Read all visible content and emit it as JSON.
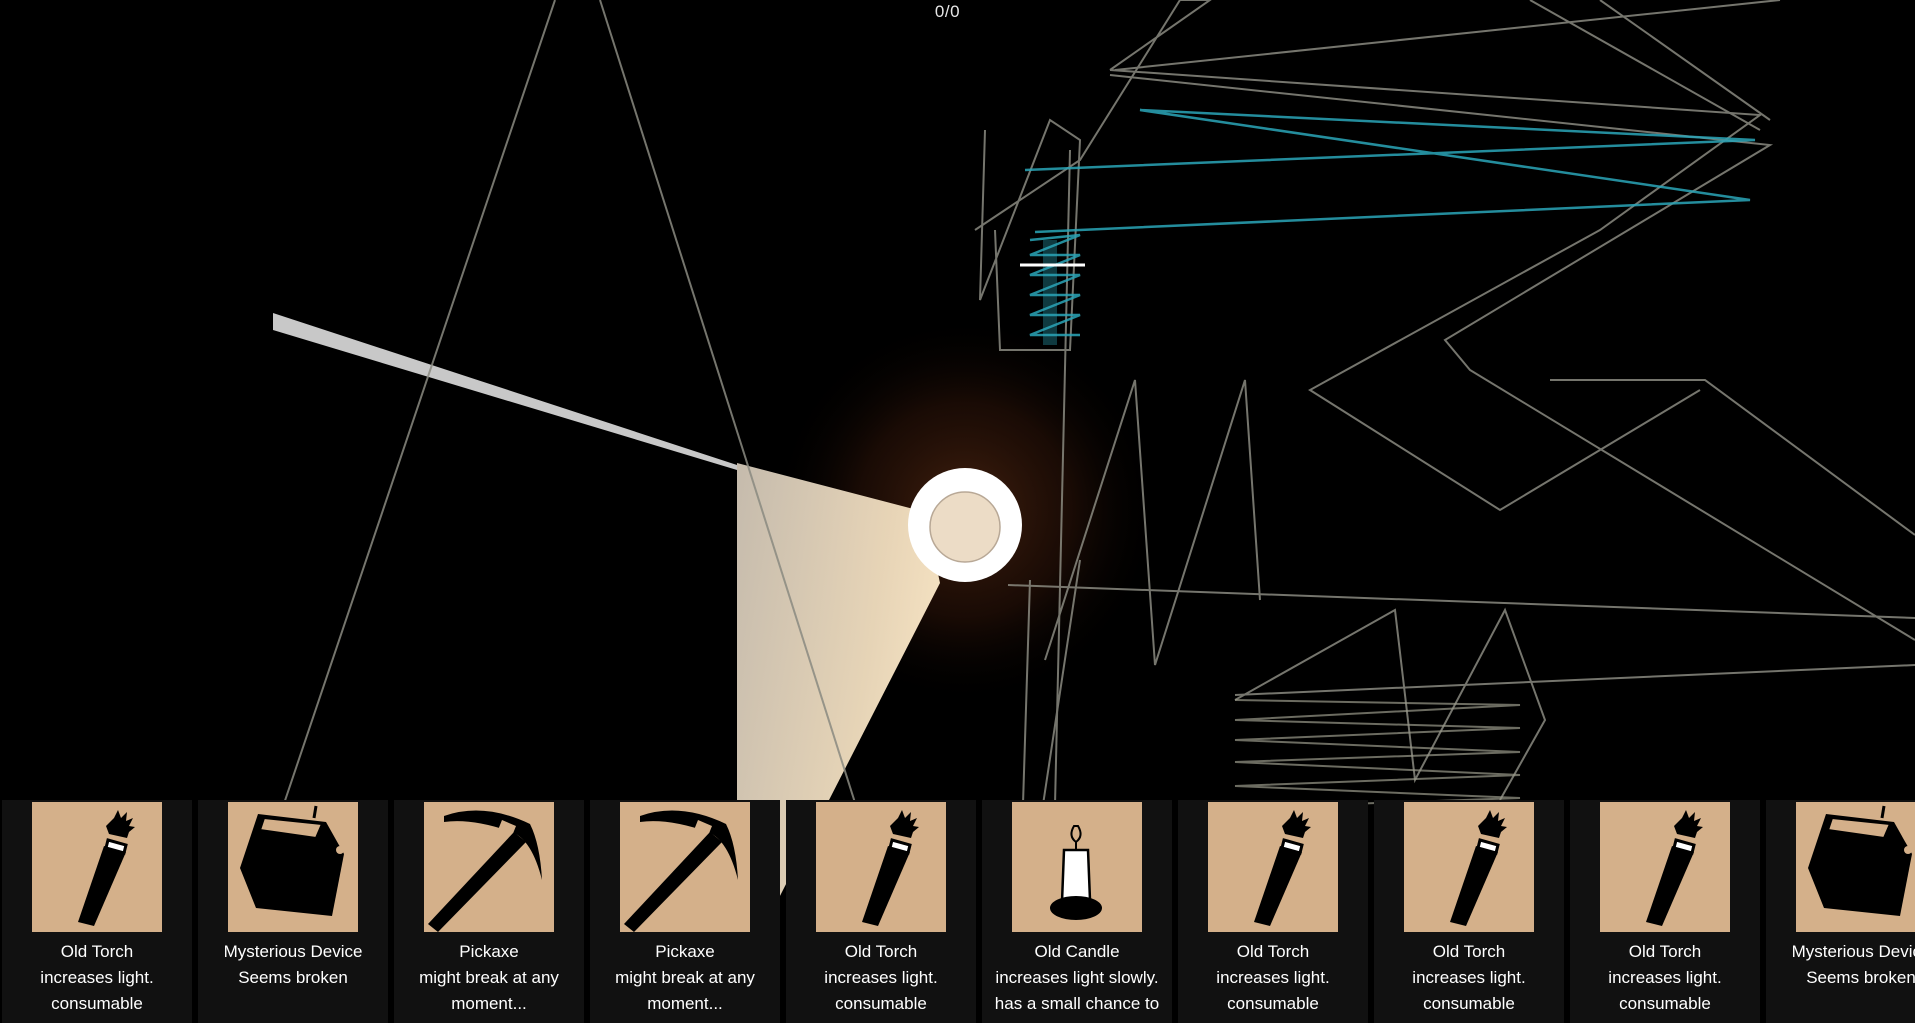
{
  "hud": {
    "counter": "0/0"
  },
  "colors": {
    "background": "#000000",
    "slot_bg": "#111111",
    "thumb_bg": "#d4b08a",
    "wall_line": "#8a8a80",
    "glow_line": "#2aa6b8",
    "light_cone": "#f3e3c8",
    "text": "#ffffff"
  },
  "inventory": {
    "items": [
      {
        "name": "Old Torch",
        "description": "increases light.\nconsumable",
        "icon": "torch-icon"
      },
      {
        "name": "Mysterious Device",
        "description": "Seems broken",
        "icon": "device-icon"
      },
      {
        "name": "Pickaxe",
        "description": "might break at any\nmoment...",
        "icon": "pickaxe-icon"
      },
      {
        "name": "Pickaxe",
        "description": "might break at any\nmoment...",
        "icon": "pickaxe-icon"
      },
      {
        "name": "Old Torch",
        "description": "increases light.\nconsumable",
        "icon": "torch-icon"
      },
      {
        "name": "Old Candle",
        "description": "increases light slowly.\nhas a small chance to",
        "icon": "candle-icon"
      },
      {
        "name": "Old Torch",
        "description": "increases light.\nconsumable",
        "icon": "torch-icon"
      },
      {
        "name": "Old Torch",
        "description": "increases light.\nconsumable",
        "icon": "torch-icon"
      },
      {
        "name": "Old Torch",
        "description": "increases light.\nconsumable",
        "icon": "torch-icon"
      },
      {
        "name": "Mysterious Device",
        "description": "Seems broken",
        "icon": "device-icon"
      }
    ]
  }
}
